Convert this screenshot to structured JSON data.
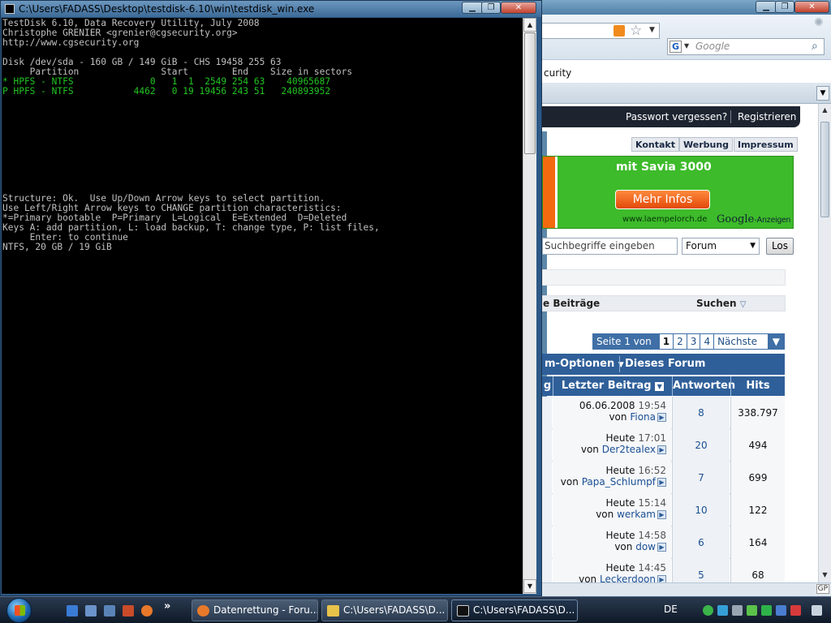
{
  "console": {
    "title": "C:\\Users\\FADASS\\Desktop\\testdisk-6.10\\win\\testdisk_win.exe",
    "lines": [
      "TestDisk 6.10, Data Recovery Utility, July 2008",
      "Christophe GRENIER <grenier@cgsecurity.org>",
      "http://www.cgsecurity.org",
      "",
      "Disk /dev/sda - 160 GB / 149 GiB - CHS 19458 255 63",
      "     Partition               Start        End    Size in sectors",
      "* HPFS - NTFS              0   1  1  2549 254 63    40965687",
      "P HPFS - NTFS           4462   0 19 19456 243 51   240893952",
      "",
      "",
      "",
      "",
      "",
      "",
      "",
      "",
      "",
      "",
      "Structure: Ok.  Use Up/Down Arrow keys to select partition.",
      "Use Left/Right Arrow keys to CHANGE partition characteristics:",
      "*=Primary bootable  P=Primary  L=Logical  E=Extended  D=Deleted",
      "Keys A: add partition, L: load backup, T: change type, P: list files,",
      "     Enter: to continue",
      "NTFS, 20 GB / 19 GiB"
    ],
    "highlight_color": "#22c522",
    "text_color": "#c0c0c0"
  },
  "browser": {
    "search_placeholder": "Google",
    "tab_fragment": "curity",
    "login": {
      "forgot": "Passwort vergessen?",
      "register": "Registrieren"
    },
    "top_links": [
      "Kontakt",
      "Werbung",
      "Impressum"
    ],
    "ad": {
      "title": "mit Savia 3000",
      "button": "Mehr Infos",
      "url": "www.laempelorch.de",
      "google": "Google",
      "google_suffix": "-Anzeigen"
    },
    "search": {
      "input": "Suchbegriffe eingeben",
      "scope": "Forum",
      "button": "Los"
    },
    "subhead": {
      "left": "e Beiträge",
      "right": "Suchen"
    },
    "pager": {
      "info": "Seite 1 von 4",
      "pages": [
        "1",
        "2",
        "3",
        "4"
      ],
      "next": "Nächste >"
    },
    "tools": {
      "options": "m-Optionen",
      "search_forum": "Dieses Forum durchsuchen"
    },
    "columns": {
      "first": "g",
      "last_post": "Letzter Beitrag",
      "replies": "Antworten",
      "hits": "Hits"
    },
    "threads": [
      {
        "date": "06.06.2008",
        "time": "19:54",
        "by": "von",
        "user": "Fiona",
        "replies": "8",
        "hits": "338.797"
      },
      {
        "date": "Heute",
        "time": "17:01",
        "by": "von",
        "user": "Der2tealex",
        "replies": "20",
        "hits": "494"
      },
      {
        "date": "Heute",
        "time": "16:52",
        "by": "von",
        "user": "Papa_Schlumpf",
        "replies": "7",
        "hits": "699"
      },
      {
        "date": "Heute",
        "time": "15:14",
        "by": "von",
        "user": "werkam",
        "replies": "10",
        "hits": "122"
      },
      {
        "date": "Heute",
        "time": "14:58",
        "by": "von",
        "user": "dow",
        "replies": "6",
        "hits": "164"
      },
      {
        "date": "Heute",
        "time": "14:45",
        "by": "von",
        "user": "Leckerdoon",
        "replies": "5",
        "hits": "68"
      }
    ],
    "status_label": "GP"
  },
  "taskbar": {
    "tasks": [
      {
        "label": "Datenrettung - Foru...",
        "active": false
      },
      {
        "label": "C:\\Users\\FADASS\\D...",
        "active": false
      },
      {
        "label": "C:\\Users\\FADASS\\D...",
        "active": true
      }
    ],
    "language": "DE",
    "more": "»"
  },
  "colors": {
    "forum_blue": "#2f5f99",
    "ad_green": "#3dbb2a",
    "ad_orange": "#f36a0f",
    "login_bar": "#1d2430"
  }
}
